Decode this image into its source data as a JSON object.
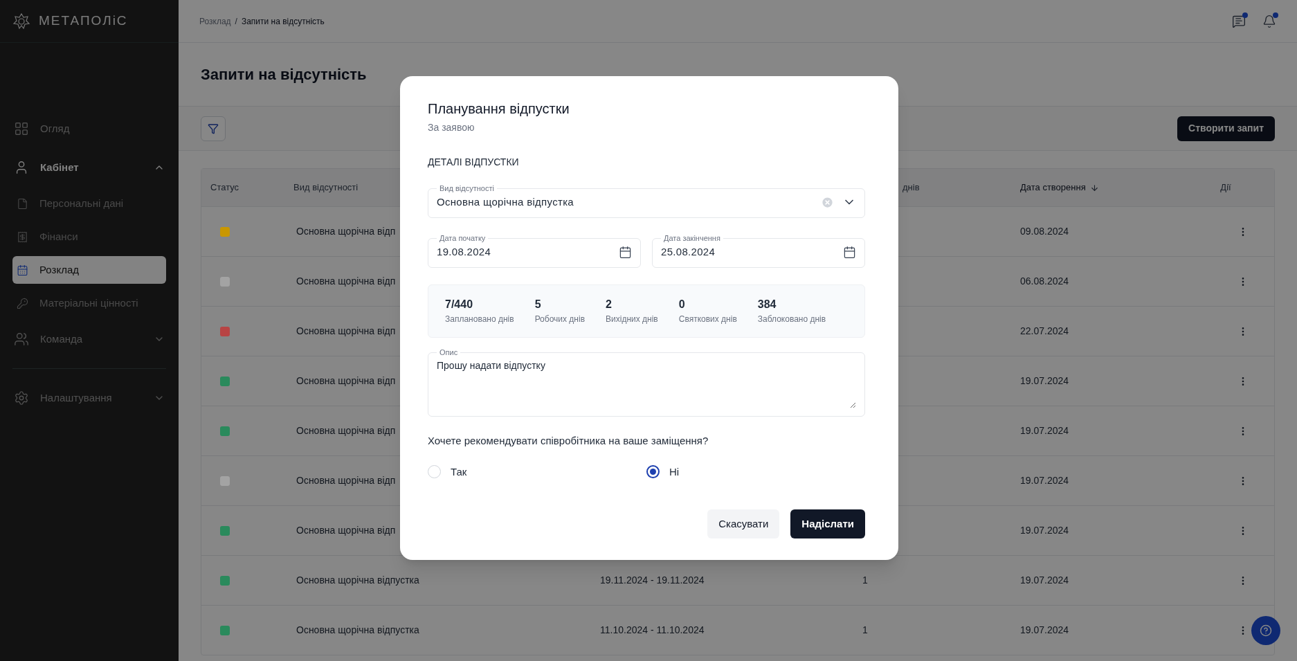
{
  "logo": {
    "text": "МЕТАПОЛіС"
  },
  "sidebar": {
    "items": [
      {
        "label": "Огляд",
        "kind": "link",
        "selected": false
      },
      {
        "label": "Кабінет",
        "kind": "group",
        "selected": true,
        "expanded": true,
        "children": [
          {
            "label": "Персональні дані",
            "selected": false
          },
          {
            "label": "Фінанси",
            "selected": false
          },
          {
            "label": "Розклад",
            "selected": true
          },
          {
            "label": "Матеріальні цінності",
            "selected": false
          }
        ]
      },
      {
        "label": "Команда",
        "kind": "group",
        "selected": false,
        "expanded": false
      },
      {
        "label": "Налаштування",
        "kind": "group",
        "selected": false,
        "expanded": false
      }
    ]
  },
  "breadcrumb": {
    "separator": "/",
    "items": [
      {
        "label": "Розклад"
      },
      {
        "label": "Запити на відсутність"
      }
    ]
  },
  "page": {
    "title": "Запити на відсутність",
    "create_button": "Створити запит"
  },
  "table": {
    "columns": [
      {
        "label": "Статус",
        "sorted": false
      },
      {
        "label": "Вид відсутності",
        "sorted": false
      },
      {
        "label": "днів",
        "sorted": false
      },
      {
        "label": "Дата створення",
        "sorted": true
      },
      {
        "label": "Дії",
        "sorted": false
      }
    ],
    "rows": [
      {
        "color": "#c99700",
        "type": "Основна щорічна відп",
        "created": "09.08.2024"
      },
      {
        "color": "#a3a3a3",
        "type": "Основна щорічна відп",
        "created": "06.08.2024"
      },
      {
        "color": "#b84444",
        "type": "Основна щорічна відп",
        "created": "22.07.2024"
      },
      {
        "color": "#2a8a5c",
        "type": "Основна щорічна відп",
        "created": "19.07.2024"
      },
      {
        "color": "#2a8a5c",
        "type": "Основна щорічна відп",
        "created": "19.07.2024"
      },
      {
        "color": "#a3a3a3",
        "type": "Основна щорічна відп",
        "created": "19.07.2024"
      },
      {
        "color": "#2a8a5c",
        "type": "Основна щорічна відп",
        "created": "19.07.2024"
      },
      {
        "color": "#2a8a5c",
        "type": "Основна щорічна відпустка",
        "period": "19.11.2024 - 19.11.2024",
        "days": "1",
        "created": "19.07.2024"
      },
      {
        "color": "#2a8a5c",
        "type": "Основна щорічна відпустка",
        "period": "11.10.2024 - 11.10.2024",
        "days": "1",
        "created": "19.07.2024"
      }
    ]
  },
  "modal": {
    "title": "Планування відпустки",
    "subtitle": "За заявою",
    "section": "ДЕТАЛІ ВІДПУСТКИ",
    "absence_type": {
      "label": "Вид відсутності",
      "value": "Основна щорічна відпустка"
    },
    "start_date": {
      "label": "Дата початку",
      "value": "19.08.2024"
    },
    "end_date": {
      "label": "Дата закінчення",
      "value": "25.08.2024"
    },
    "stats": [
      {
        "value": "7/440",
        "label": "Заплановано днів"
      },
      {
        "value": "5",
        "label": "Робочих днів"
      },
      {
        "value": "2",
        "label": "Вихідних днів"
      },
      {
        "value": "0",
        "label": "Святкових днів"
      },
      {
        "value": "384",
        "label": "Заблоковано днів"
      }
    ],
    "description": {
      "label": "Опис",
      "value": "Прошу надати відпустку"
    },
    "question": "Хочете рекомендувати співробітника на ваше заміщення?",
    "options": [
      {
        "label": "Так",
        "selected": false
      },
      {
        "label": "Ні",
        "selected": true
      }
    ],
    "buttons": [
      {
        "label": "Скасувати",
        "kind": "secondary"
      },
      {
        "label": "Надіслати",
        "kind": "primary"
      }
    ]
  }
}
